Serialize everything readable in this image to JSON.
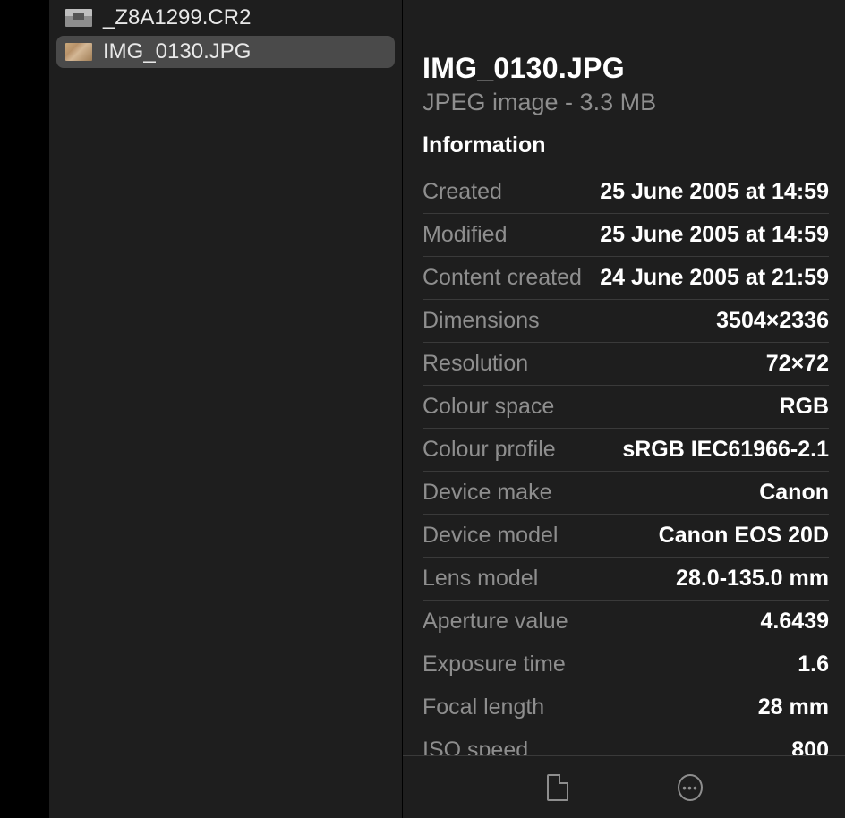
{
  "fileList": {
    "items": [
      {
        "name": "_Z8A1299.CR2",
        "selected": false
      },
      {
        "name": "IMG_0130.JPG",
        "selected": true
      }
    ]
  },
  "detail": {
    "title": "IMG_0130.JPG",
    "subtitle": "JPEG image - 3.3 MB",
    "sectionHeading": "Information",
    "rows": [
      {
        "label": "Created",
        "value": "25 June 2005 at 14:59"
      },
      {
        "label": "Modified",
        "value": "25 June 2005 at 14:59"
      },
      {
        "label": "Content created",
        "value": "24 June 2005 at 21:59"
      },
      {
        "label": "Dimensions",
        "value": "3504×2336"
      },
      {
        "label": "Resolution",
        "value": "72×72"
      },
      {
        "label": "Colour space",
        "value": "RGB"
      },
      {
        "label": "Colour profile",
        "value": "sRGB IEC61966-2.1"
      },
      {
        "label": "Device make",
        "value": "Canon"
      },
      {
        "label": "Device model",
        "value": "Canon EOS 20D"
      },
      {
        "label": "Lens model",
        "value": "28.0-135.0 mm"
      },
      {
        "label": "Aperture value",
        "value": "4.6439"
      },
      {
        "label": "Exposure time",
        "value": "1.6"
      },
      {
        "label": "Focal length",
        "value": "28 mm"
      },
      {
        "label": "ISO speed",
        "value": "800"
      }
    ]
  }
}
